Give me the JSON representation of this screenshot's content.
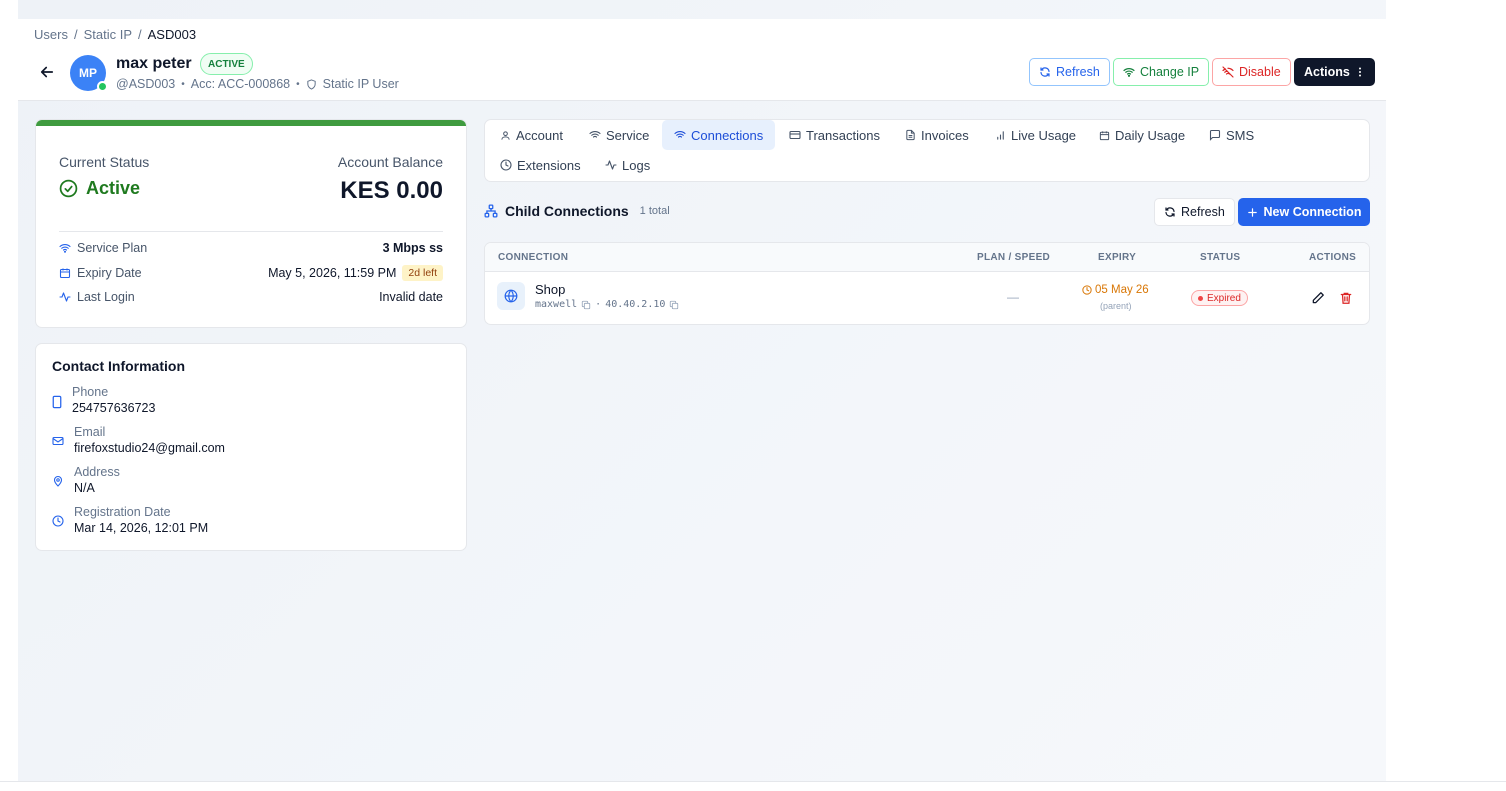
{
  "breadcrumb": [
    "Users",
    "Static IP",
    "ASD003"
  ],
  "breadcrumb_sep": "/",
  "user": {
    "initials": "MP",
    "name": "max peter",
    "status_pill": "ACTIVE",
    "username": "@ASD003",
    "account": "Acc: ACC-000868",
    "type": "Static IP User",
    "meta_sep": "•"
  },
  "header_actions": {
    "refresh": "Refresh",
    "change_ip": "Change IP",
    "disable": "Disable",
    "actions": "Actions"
  },
  "status_card": {
    "current_status_label": "Current Status",
    "current_status_value": "Active",
    "balance_label": "Account Balance",
    "balance_value": "KES 0.00",
    "service_plan_label": "Service Plan",
    "service_plan_value": "3 Mbps ss",
    "expiry_label": "Expiry Date",
    "expiry_value": "May 5, 2026, 11:59 PM",
    "expiry_badge": "2d left",
    "last_login_label": "Last Login",
    "last_login_value": "Invalid date"
  },
  "contact": {
    "title": "Contact Information",
    "phone_label": "Phone",
    "phone_value": "254757636723",
    "email_label": "Email",
    "email_value": "firefoxstudio24@gmail.com",
    "address_label": "Address",
    "address_value": "N/A",
    "reg_label": "Registration Date",
    "reg_value": "Mar 14, 2026, 12:01 PM"
  },
  "tabs": [
    "Account",
    "Service",
    "Connections",
    "Transactions",
    "Invoices",
    "Live Usage",
    "Daily Usage",
    "SMS",
    "Extensions",
    "Logs"
  ],
  "active_tab": "Connections",
  "child_connections": {
    "title": "Child Connections",
    "count": "1 total",
    "refresh": "Refresh",
    "new": "New Connection",
    "columns": [
      "CONNECTION",
      "PLAN / SPEED",
      "EXPIRY",
      "STATUS",
      "ACTIONS"
    ],
    "rows": [
      {
        "name": "Shop",
        "username": "maxwell",
        "ip": "40.40.2.10",
        "plan": "—",
        "expiry": "05 May 26",
        "expiry_note": "(parent)",
        "status": "Expired"
      }
    ]
  },
  "colors": {
    "primary": "#2563eb",
    "success": "#1f7a1f",
    "danger": "#dc2626",
    "warning": "#d97706",
    "dark": "#0f172a"
  }
}
